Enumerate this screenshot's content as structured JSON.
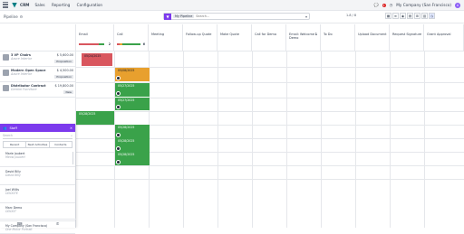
{
  "app": {
    "name": "CRM",
    "menu": [
      "Sales",
      "Reporting",
      "Configuration"
    ],
    "company": "My Company (San Francisco)",
    "notif_count": "1"
  },
  "control": {
    "breadcrumb": "Pipeline",
    "facet": "My Pipeline",
    "search_placeholder": "Search...",
    "pager": "1-8 / 8"
  },
  "rows": [
    {
      "name": "3 VP Chairs",
      "sub": "Azure Interior",
      "amount": "$ 5,600.00",
      "tag": "Proposition"
    },
    {
      "name": "Modern Open Space",
      "sub": "Azure Interior",
      "amount": "$ 4,500.00",
      "tag": "Proposition"
    },
    {
      "name": "Distributor Contract",
      "sub": "Gemini Furniture",
      "amount": "$ 19,800.00",
      "tag": "New"
    }
  ],
  "columns": [
    {
      "label": "Email",
      "count": "2"
    },
    {
      "label": "Call",
      "count": "6"
    },
    {
      "label": "Meeting",
      "count": ""
    },
    {
      "label": "Follow-up Quote",
      "count": ""
    },
    {
      "label": "Make Quote",
      "count": ""
    },
    {
      "label": "Call for Demo",
      "count": ""
    },
    {
      "label": "Email: Welcome Demo",
      "count": "1"
    },
    {
      "label": "To Do",
      "count": ""
    },
    {
      "label": "Upload Document",
      "count": ""
    },
    {
      "label": "Request Signature",
      "count": ""
    },
    {
      "label": "Grant Approval",
      "count": ""
    }
  ],
  "cards": [
    {
      "date": "05/24/2025",
      "color": "#d9565e"
    },
    {
      "date": "05/08/2025",
      "color": "#e8a02e"
    },
    {
      "date": "05/27/2025",
      "color": "#3aa24a"
    },
    {
      "date": "05/27/2025",
      "color": "#3aa24a"
    },
    {
      "date": "05/28/2025",
      "color": "#3aa24a"
    },
    {
      "date": "05/28/2025",
      "color": "#3aa24a"
    },
    {
      "date": "05/28/2025",
      "color": "#3aa24a"
    },
    {
      "date": "05/28/2025",
      "color": "#3aa24a"
    }
  ],
  "pane": {
    "title": "Staff",
    "search_placeholder": "Search",
    "tabs": [
      "Recent",
      "Next Activities",
      "Contacts"
    ],
    "contacts": [
      {
        "name": "Marie Joubert",
        "company": "Meow Joubert"
      },
      {
        "name": "David Billy",
        "company": "David Billy"
      },
      {
        "name": "Joel Willis",
        "company": "ODOOTE"
      },
      {
        "name": "Marc Demo",
        "company": "ODOOT"
      },
      {
        "name": "My Company (San Francisco)",
        "company": "One Motor Portrait"
      }
    ]
  }
}
